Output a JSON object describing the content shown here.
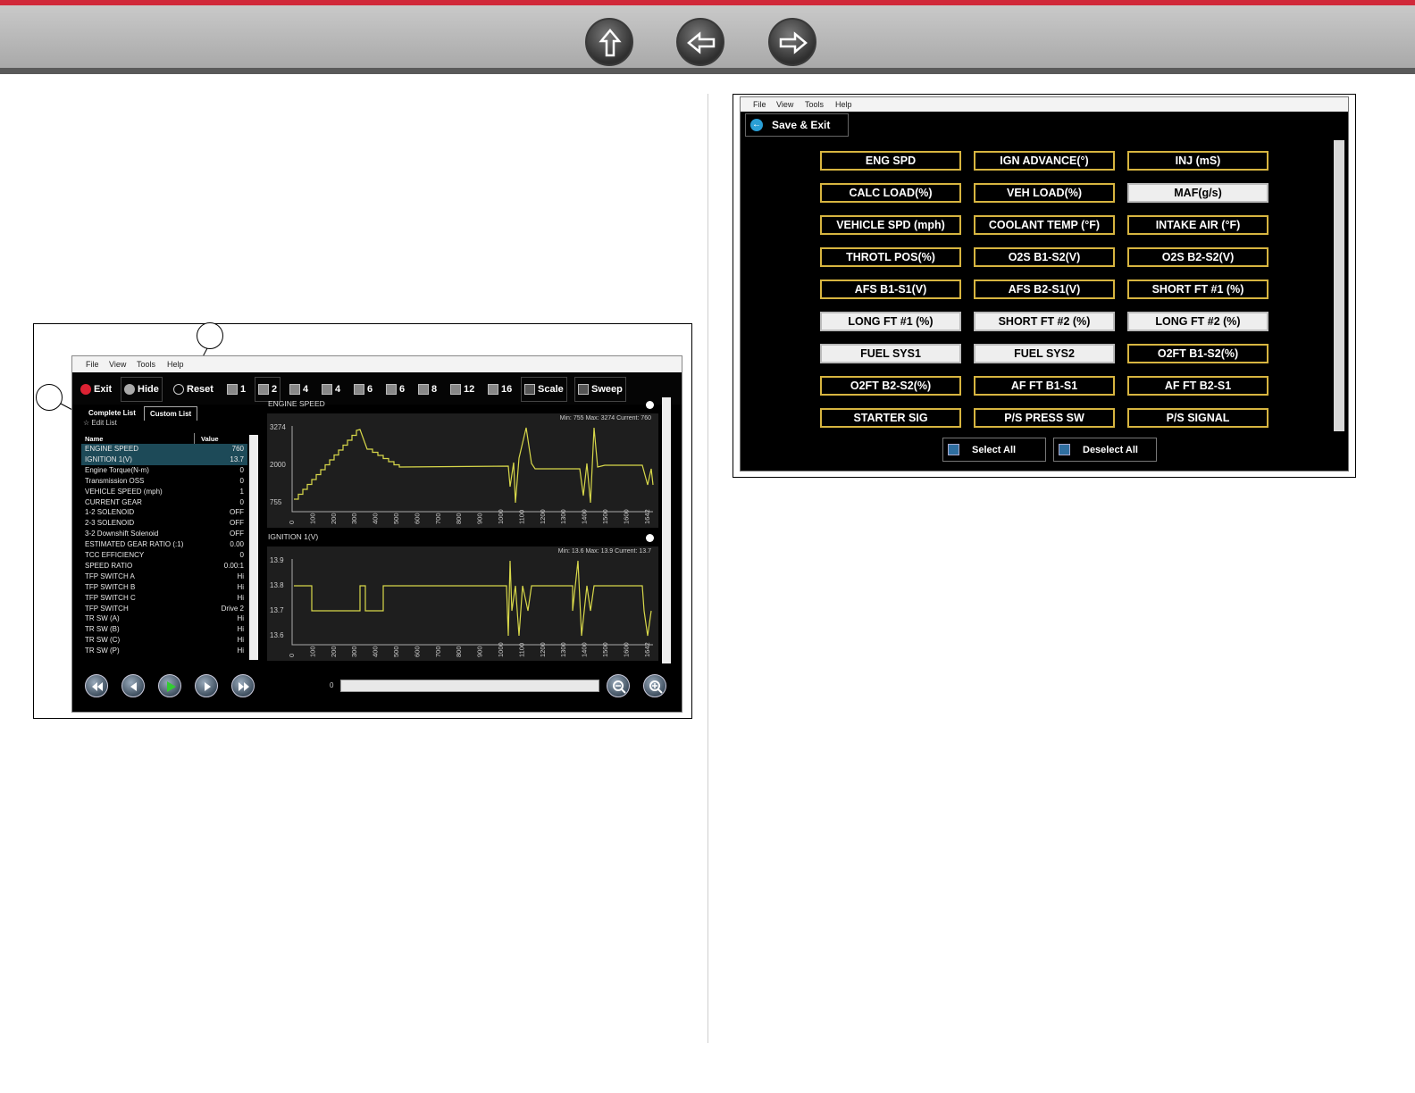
{
  "nav": {
    "buttons": [
      "up-arrow-icon",
      "back-arrow-icon",
      "forward-arrow-icon"
    ]
  },
  "data_scan": {
    "menu": [
      "File",
      "View",
      "Tools",
      "Help"
    ],
    "toolbar": {
      "exit": "Exit",
      "hide": "Hide",
      "reset": "Reset",
      "layouts": [
        "1",
        "2",
        "4",
        "4",
        "6",
        "6",
        "8",
        "12",
        "16"
      ],
      "scale": "Scale",
      "sweep": "Sweep"
    },
    "tabs": {
      "complete": "Complete List",
      "custom": "Custom List"
    },
    "edit_list": "Edit List",
    "columns": {
      "name": "Name",
      "value": "Value"
    },
    "pids": [
      {
        "name": "ENGINE SPEED",
        "value": "760"
      },
      {
        "name": "IGNITION 1(V)",
        "value": "13.7"
      },
      {
        "name": "Engine Torque(N-m)",
        "value": "0"
      },
      {
        "name": "Transmission OSS",
        "value": "0"
      },
      {
        "name": "VEHICLE SPEED (mph)",
        "value": "1"
      },
      {
        "name": "CURRENT GEAR",
        "value": "0"
      },
      {
        "name": "1-2 SOLENOID",
        "value": "OFF"
      },
      {
        "name": "2-3 SOLENOID",
        "value": "OFF"
      },
      {
        "name": "3-2 Downshift Solenoid",
        "value": "OFF"
      },
      {
        "name": "ESTIMATED GEAR RATIO (:1)",
        "value": "0.00"
      },
      {
        "name": "TCC EFFICIENCY",
        "value": "0"
      },
      {
        "name": "SPEED RATIO",
        "value": "0.00:1"
      },
      {
        "name": "TFP SWITCH A",
        "value": "Hi"
      },
      {
        "name": "TFP SWITCH B",
        "value": "Hi"
      },
      {
        "name": "TFP SWITCH C",
        "value": "Hi"
      },
      {
        "name": "TFP SWITCH",
        "value": "Drive 2"
      },
      {
        "name": "TR SW (A)",
        "value": "Hi"
      },
      {
        "name": "TR SW (B)",
        "value": "Hi"
      },
      {
        "name": "TR SW (C)",
        "value": "Hi"
      },
      {
        "name": "TR SW (P)",
        "value": "Hi"
      }
    ],
    "graph1": {
      "title": "ENGINE SPEED",
      "stats": "Min: 755    Max: 3274    Current: 760",
      "yticks": [
        "3274",
        "2000",
        "755"
      ]
    },
    "graph2": {
      "title": "IGNITION 1(V)",
      "stats": "Min: 13.6    Max: 13.9    Current: 13.7",
      "yticks": [
        "13.9",
        "13.8",
        "13.7",
        "13.6"
      ]
    },
    "xticks": [
      "0",
      "100",
      "200",
      "300",
      "400",
      "500",
      "600",
      "700",
      "800",
      "900",
      "1000",
      "1100",
      "1200",
      "1300",
      "1400",
      "1500",
      "1600",
      "1642"
    ],
    "slider_start": "0"
  },
  "pid_select": {
    "menu": [
      "File",
      "View",
      "Tools",
      "Help"
    ],
    "save_exit": "Save & Exit",
    "pids": [
      {
        "label": "ENG SPD",
        "selected": false
      },
      {
        "label": "IGN ADVANCE(°)",
        "selected": false
      },
      {
        "label": "INJ (mS)",
        "selected": false
      },
      {
        "label": "CALC LOAD(%)",
        "selected": false
      },
      {
        "label": "VEH LOAD(%)",
        "selected": false
      },
      {
        "label": "MAF(g/s)",
        "selected": true
      },
      {
        "label": "VEHICLE SPD (mph)",
        "selected": false
      },
      {
        "label": "COOLANT TEMP (°F)",
        "selected": false
      },
      {
        "label": "INTAKE AIR (°F)",
        "selected": false
      },
      {
        "label": "THROTL POS(%)",
        "selected": false
      },
      {
        "label": "O2S B1-S2(V)",
        "selected": false
      },
      {
        "label": "O2S B2-S2(V)",
        "selected": false
      },
      {
        "label": "AFS B1-S1(V)",
        "selected": false
      },
      {
        "label": "AFS B2-S1(V)",
        "selected": false
      },
      {
        "label": "SHORT FT #1 (%)",
        "selected": false
      },
      {
        "label": "LONG FT #1 (%)",
        "selected": true
      },
      {
        "label": "SHORT FT #2 (%)",
        "selected": true
      },
      {
        "label": "LONG FT #2 (%)",
        "selected": true
      },
      {
        "label": "FUEL SYS1",
        "selected": true
      },
      {
        "label": "FUEL SYS2",
        "selected": true
      },
      {
        "label": "O2FT B1-S2(%)",
        "selected": false
      },
      {
        "label": "O2FT B2-S2(%)",
        "selected": false
      },
      {
        "label": "AF FT B1-S1",
        "selected": false
      },
      {
        "label": "AF FT B2-S1",
        "selected": false
      },
      {
        "label": "STARTER SIG",
        "selected": false
      },
      {
        "label": "P/S PRESS SW",
        "selected": false
      },
      {
        "label": "P/S SIGNAL",
        "selected": false
      }
    ],
    "select_all": "Select All",
    "deselect_all": "Deselect All"
  },
  "colors": {
    "accent_red": "#d1293a",
    "pid_border": "#d7b540",
    "graph_line": "#d8d84a"
  }
}
